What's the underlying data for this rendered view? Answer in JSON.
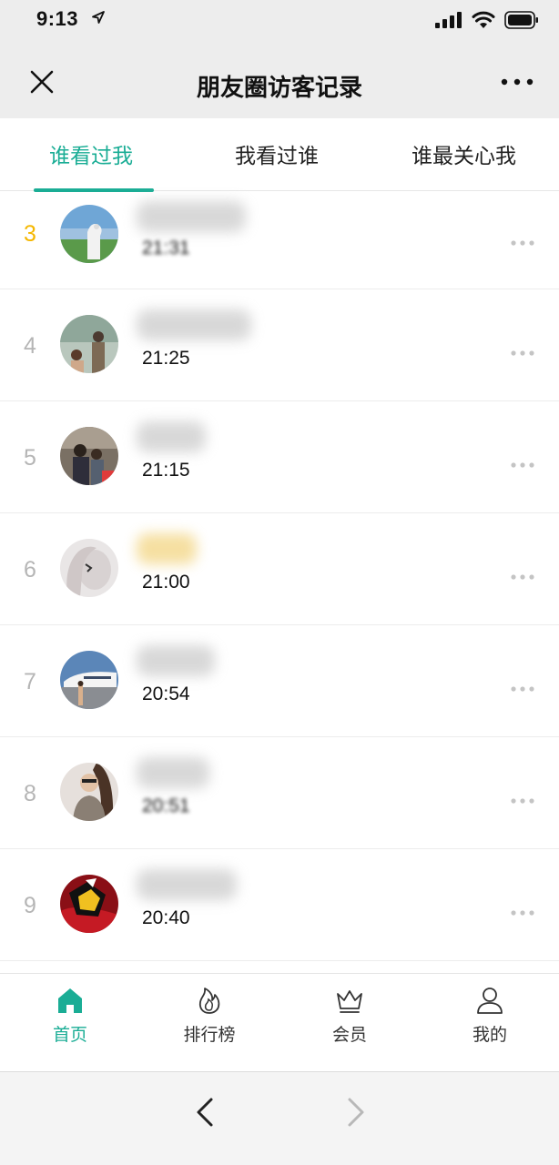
{
  "status_bar": {
    "time": "9:13",
    "icons": [
      "location-arrow-icon",
      "signal-icon",
      "wifi-icon",
      "battery-icon"
    ]
  },
  "nav": {
    "title": "朋友圈访客记录",
    "close_icon": "close-icon",
    "more_icon": "more-dots-icon"
  },
  "tabs": [
    {
      "label": "谁看过我",
      "active": true
    },
    {
      "label": "我看过谁",
      "active": false
    },
    {
      "label": "谁最关心我",
      "active": false
    }
  ],
  "visitors": [
    {
      "rank": "3",
      "time": "21:31",
      "name": ""
    },
    {
      "rank": "4",
      "time": "21:25",
      "name": ""
    },
    {
      "rank": "5",
      "time": "21:15",
      "name": ""
    },
    {
      "rank": "6",
      "time": "21:00",
      "name": ""
    },
    {
      "rank": "7",
      "time": "20:54",
      "name": ""
    },
    {
      "rank": "8",
      "time": "20:51",
      "name": ""
    },
    {
      "rank": "9",
      "time": "20:40",
      "name": ""
    }
  ],
  "colors": {
    "accent": "#1aad95",
    "rank_top": "#f5b700",
    "rank_normal": "#b5b5b5"
  },
  "tabbar": [
    {
      "label": "首页",
      "icon": "home-icon",
      "active": true
    },
    {
      "label": "排行榜",
      "icon": "flame-icon",
      "active": false
    },
    {
      "label": "会员",
      "icon": "crown-icon",
      "active": false
    },
    {
      "label": "我的",
      "icon": "person-icon",
      "active": false
    }
  ],
  "browser": {
    "back_icon": "chevron-left-icon",
    "forward_icon": "chevron-right-icon"
  }
}
